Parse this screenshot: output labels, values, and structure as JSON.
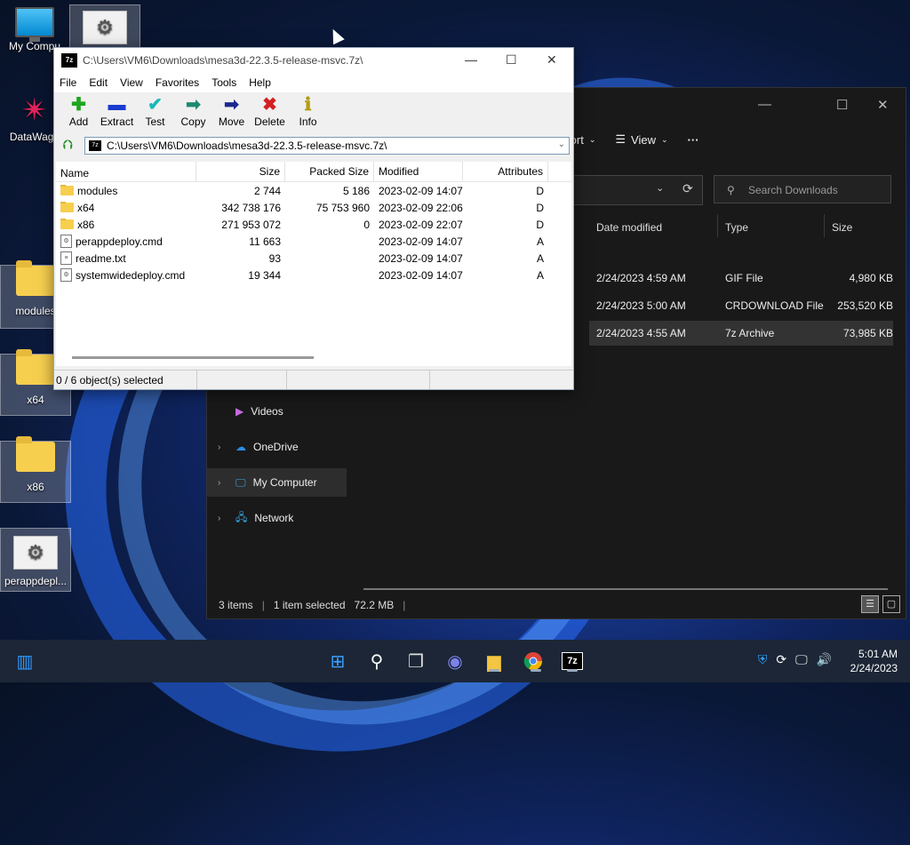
{
  "desktop": {
    "icons": [
      {
        "label": "My Compu"
      },
      {
        "label": "DataWago"
      },
      {
        "label": "modules"
      },
      {
        "label": "x64"
      },
      {
        "label": "x86"
      },
      {
        "label": "perappdepl..."
      }
    ]
  },
  "explorer": {
    "toolbar": {
      "sort": "Sort",
      "view": "View",
      "more": "···"
    },
    "search_placeholder": "Search Downloads",
    "columns": [
      "Date modified",
      "Type",
      "Size"
    ],
    "rows": [
      {
        "date": "2/24/2023 4:59 AM",
        "type": "GIF File",
        "size": "4,980 KB"
      },
      {
        "date": "2/24/2023 5:00 AM",
        "type": "CRDOWNLOAD File",
        "size": "253,520 KB"
      },
      {
        "date": "2/24/2023 4:55 AM",
        "type": "7z Archive",
        "size": "73,985 KB"
      }
    ],
    "nav": [
      {
        "label": "Videos"
      },
      {
        "label": "OneDrive"
      },
      {
        "label": "My Computer"
      },
      {
        "label": "Network"
      }
    ],
    "status": {
      "items": "3 items",
      "selected": "1 item selected",
      "size": "72.2 MB"
    }
  },
  "zip": {
    "title": "C:\\Users\\VM6\\Downloads\\mesa3d-22.3.5-release-msvc.7z\\",
    "logo": "7z",
    "menu": [
      "File",
      "Edit",
      "View",
      "Favorites",
      "Tools",
      "Help"
    ],
    "tools": [
      {
        "label": "Add",
        "glyph": "✚",
        "color": "#1fa51f"
      },
      {
        "label": "Extract",
        "glyph": "▬",
        "color": "#1a3ccf"
      },
      {
        "label": "Test",
        "glyph": "✔",
        "color": "#19b8b8"
      },
      {
        "label": "Copy",
        "glyph": "➡",
        "color": "#1d8a6e"
      },
      {
        "label": "Move",
        "glyph": "➡",
        "color": "#1b2a8f"
      },
      {
        "label": "Delete",
        "glyph": "✖",
        "color": "#d42020"
      },
      {
        "label": "Info",
        "glyph": "ℹ",
        "color": "#b29c10"
      }
    ],
    "address": "C:\\Users\\VM6\\Downloads\\mesa3d-22.3.5-release-msvc.7z\\",
    "columns": {
      "name": "Name",
      "size": "Size",
      "packed": "Packed Size",
      "modified": "Modified",
      "attributes": "Attributes"
    },
    "rows": [
      {
        "name": "modules",
        "kind": "folder",
        "size": "2 744",
        "packed": "5 186",
        "modified": "2023-02-09 14:07",
        "attr": "D"
      },
      {
        "name": "x64",
        "kind": "folder",
        "size": "342 738 176",
        "packed": "75 753 960",
        "modified": "2023-02-09 22:06",
        "attr": "D"
      },
      {
        "name": "x86",
        "kind": "folder",
        "size": "271 953 072",
        "packed": "0",
        "modified": "2023-02-09 22:07",
        "attr": "D"
      },
      {
        "name": "perappdeploy.cmd",
        "kind": "file",
        "size": "11 663",
        "packed": "",
        "modified": "2023-02-09 14:07",
        "attr": "A"
      },
      {
        "name": "readme.txt",
        "kind": "file",
        "size": "93",
        "packed": "",
        "modified": "2023-02-09 14:07",
        "attr": "A"
      },
      {
        "name": "systemwidedeploy.cmd",
        "kind": "file",
        "size": "19 344",
        "packed": "",
        "modified": "2023-02-09 14:07",
        "attr": "A"
      }
    ],
    "status": "0 / 6 object(s) selected"
  },
  "taskbar": {
    "time": "5:01 AM",
    "date": "2/24/2023",
    "apps": [
      "windows-start-icon",
      "search-icon",
      "task-view-icon",
      "chat-icon",
      "file-explorer-icon",
      "chrome-icon",
      "7zip-icon"
    ]
  }
}
